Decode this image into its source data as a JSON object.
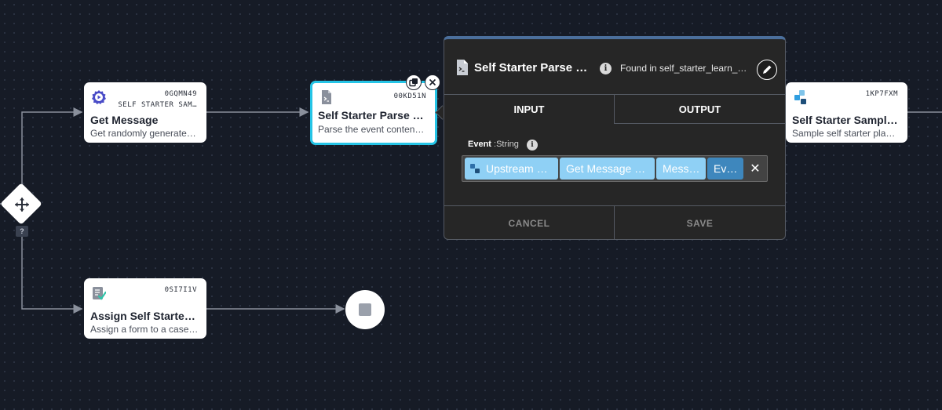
{
  "nodes": {
    "get_message": {
      "id": "0GQMN49",
      "type": "SELF STARTER SAM…",
      "title": "Get Message",
      "description": "Get randomly generate…",
      "icon": "play-chip-icon"
    },
    "parse": {
      "id": "00KD51N",
      "title": "Self Starter Parse …",
      "description": "Parse the event conten…",
      "icon": "script-file-icon"
    },
    "sample": {
      "id": "1KP7FXM",
      "title": "Self Starter Sampl…",
      "description": "Sample self starter pla…",
      "icon": "blocks-icon"
    },
    "assign": {
      "id": "0SI7I1V",
      "title": "Assign Self Starte…",
      "description": "Assign a form to a case…",
      "icon": "form-check-icon"
    }
  },
  "branch_badge": "?",
  "panel": {
    "title": "Self Starter Parse …",
    "found_in": "Found in self_starter_learn_…",
    "tabs": [
      "INPUT",
      "OUTPUT"
    ],
    "field": {
      "name": "Event",
      "type": ":String"
    },
    "path_chips": [
      "Upstream …",
      "Get Message …",
      "Mess…",
      "Ev…"
    ],
    "cancel_label": "CANCEL",
    "save_label": "SAVE"
  },
  "colors": {
    "accent": "#25c4e6",
    "chip": "#8fd0f5",
    "chip_active": "#3e87bd",
    "canvas": "#161b26"
  }
}
